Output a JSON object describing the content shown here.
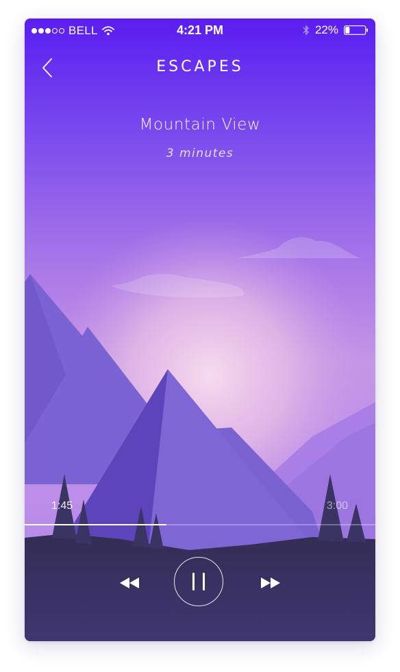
{
  "status_bar": {
    "signal_bars_filled": 3,
    "signal_bars_total": 5,
    "carrier": "BELL",
    "time": "4:21 PM",
    "battery_percent_label": "22%",
    "battery_level": 0.22,
    "icons": [
      "wifi-icon",
      "bluetooth-icon",
      "battery-icon"
    ]
  },
  "nav": {
    "back_icon": "chevron-left-icon",
    "title": "ESCAPES"
  },
  "track": {
    "title": "Mountain View",
    "duration": "3 minutes"
  },
  "player": {
    "elapsed": "1:45",
    "total": "3:00",
    "progress": 0.405,
    "controls": {
      "rewind_icon": "rewind-icon",
      "pause_icon": "pause-icon",
      "forward_icon": "fast-forward-icon"
    }
  },
  "colors": {
    "sky_top": "#5a1df0",
    "sky_mid": "#9d6ce8",
    "glow": "#f2d2ec",
    "mountain_far": "#7862d2",
    "mountain_near": "#6a4fc4",
    "ground": "#37325c",
    "accent_white": "#ffffff"
  }
}
